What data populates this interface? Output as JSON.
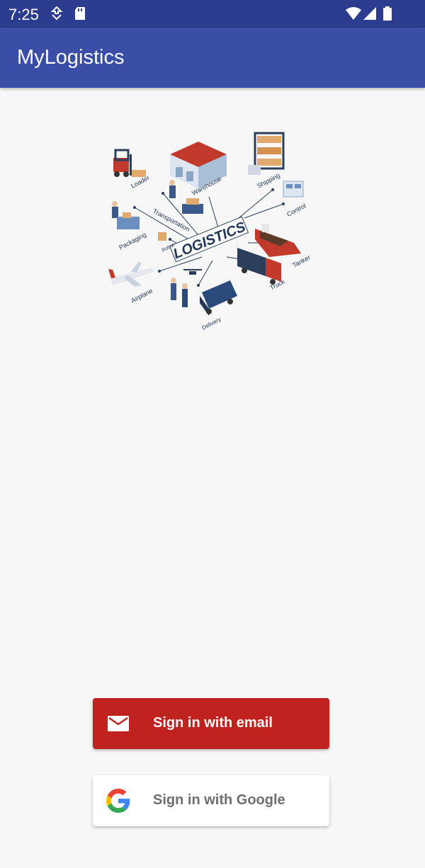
{
  "status_bar": {
    "time": "7:25",
    "icons": [
      "download-icon",
      "sd-card-icon",
      "wifi-icon",
      "signal-icon",
      "battery-icon"
    ]
  },
  "app_bar": {
    "title": "MyLogistics"
  },
  "illustration": {
    "center_label": "LOGISTICS",
    "labels": [
      "Loader",
      "Warehouse",
      "Shipping",
      "Transportation",
      "Control",
      "Packaging",
      "Robot",
      "Tanker",
      "Airplane",
      "Truck",
      "Delivery"
    ]
  },
  "buttons": {
    "email_label": "Sign in with email",
    "google_label": "Sign in with Google"
  },
  "colors": {
    "status_bar": "#2c3d8f",
    "app_bar": "#3a4ea8",
    "email_button": "#c0221f",
    "google_button": "#ffffff",
    "background": "#f7f7f7"
  }
}
